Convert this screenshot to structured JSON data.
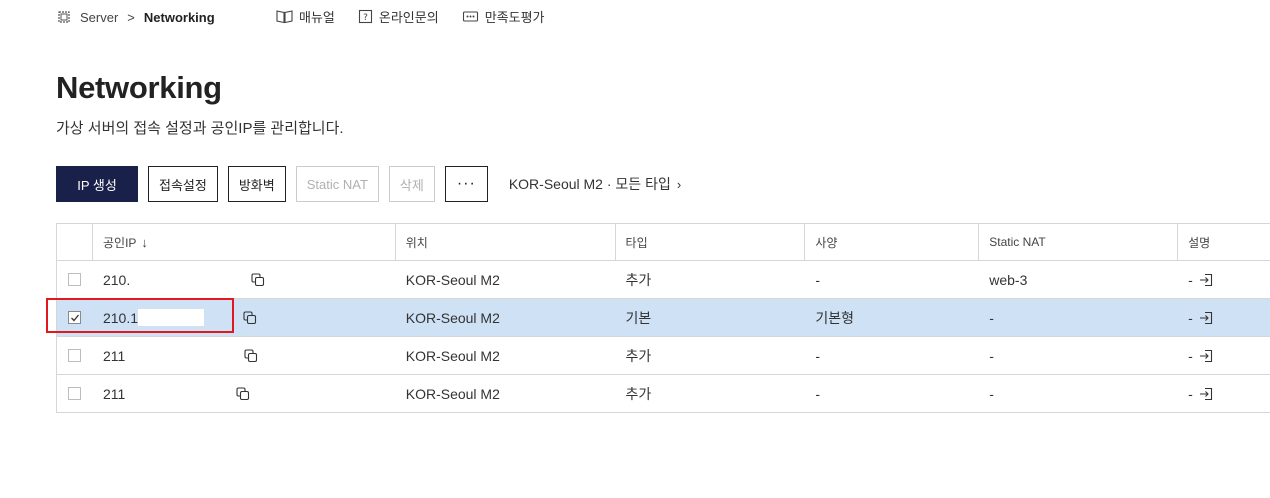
{
  "breadcrumb": {
    "root": "Server",
    "separator": ">",
    "current": "Networking"
  },
  "toplinks": [
    {
      "label": "매뉴얼",
      "icon": "book-icon"
    },
    {
      "label": "온라인문의",
      "icon": "question-icon"
    },
    {
      "label": "만족도평가",
      "icon": "chat-icon"
    }
  ],
  "page": {
    "title": "Networking",
    "description": "가상 서버의 접속 설정과 공인IP를 관리합니다."
  },
  "toolbar": {
    "create_ip": "IP 생성",
    "access_settings": "접속설정",
    "firewall": "방화벽",
    "static_nat": "Static NAT",
    "delete": "삭제",
    "more": "···",
    "filter_label": "KOR-Seoul M2 · 모든 타입",
    "filter_chevron": "›"
  },
  "table": {
    "columns": {
      "ip": "공인IP",
      "sort": "↓",
      "location": "위치",
      "type": "타입",
      "spec": "사양",
      "static_nat": "Static NAT",
      "description": "설명"
    },
    "rows": [
      {
        "ip": "210.",
        "location": "KOR-Seoul M2",
        "type": "추가",
        "spec": "-",
        "static_nat": "web-3",
        "description": "-",
        "checked": false
      },
      {
        "ip": "210.1",
        "location": "KOR-Seoul M2",
        "type": "기본",
        "spec": "기본형",
        "static_nat": "-",
        "description": "-",
        "checked": true
      },
      {
        "ip": "211",
        "location": "KOR-Seoul M2",
        "type": "추가",
        "spec": "-",
        "static_nat": "-",
        "description": "-",
        "checked": false
      },
      {
        "ip": "211",
        "location": "KOR-Seoul M2",
        "type": "추가",
        "spec": "-",
        "static_nat": "-",
        "description": "-",
        "checked": false
      }
    ]
  },
  "colors": {
    "primary": "#19214a",
    "selected_row": "#cfe1f5",
    "highlight": "#e0191f"
  }
}
